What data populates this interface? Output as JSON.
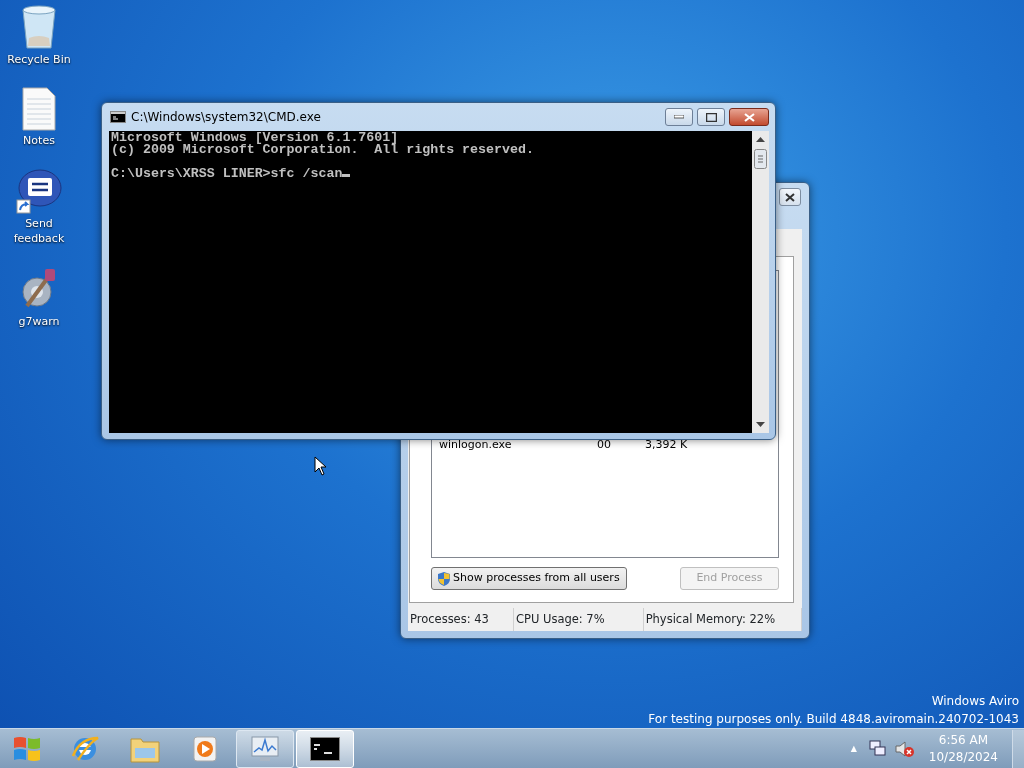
{
  "desktop_icons": [
    {
      "label": "Recycle Bin",
      "kind": "bin"
    },
    {
      "label": "Notes",
      "kind": "document"
    },
    {
      "label": "Send\nfeedback",
      "kind": "feedback"
    },
    {
      "label": "g7warn",
      "kind": "tool"
    }
  ],
  "task_manager": {
    "rows": [
      {
        "name": "winlogon.exe",
        "cpu": "00",
        "memory": "3,392 K"
      }
    ],
    "buttons": [
      {
        "label": "Show processes from all users",
        "kind": "shield",
        "disabled": false
      },
      {
        "label": "End Process",
        "kind": "plain",
        "disabled": true
      }
    ],
    "status_bar": [
      "Processes: 43",
      "CPU Usage: 7%",
      "Physical Memory: 22%"
    ]
  },
  "cmd_window": {
    "title": "C:\\Windows\\system32\\CMD.exe",
    "lines": [
      "Microsoft Windows [Version 6.1.7601]",
      "(c) 2009 Microsoft Corporation.  All rights reserved."
    ],
    "prompt": "C:\\Users\\XRSS LINER>sfc /scan"
  },
  "desktop_watermark": [
    "Windows Aviro",
    "For testing purposes only. Build 4848.aviromain.240702-1043"
  ],
  "taskbar": {
    "items": [
      {
        "kind": "start",
        "selected": false
      },
      {
        "kind": "browser",
        "selected": false
      },
      {
        "kind": "folder",
        "selected": false
      },
      {
        "kind": "media",
        "selected": false
      },
      {
        "kind": "monitor",
        "selected": false
      },
      {
        "kind": "console",
        "selected": true
      }
    ],
    "tray_arrow": "▲",
    "clock": {
      "time": "6:56 AM",
      "date": "10/28/2024"
    }
  }
}
